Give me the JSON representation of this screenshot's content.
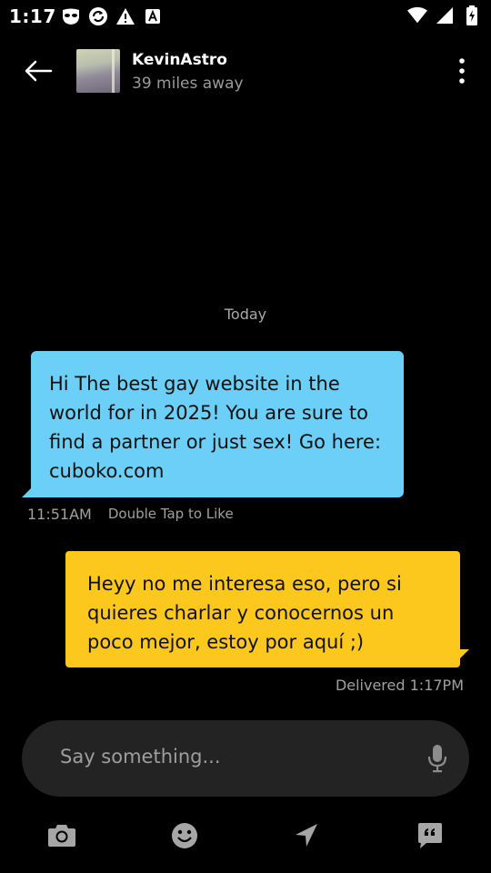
{
  "status_bar": {
    "time": "1:17",
    "left_icons": [
      "mask-icon",
      "sync-icon",
      "warning-icon",
      "app-a-icon"
    ],
    "right_icons": [
      "wifi-icon",
      "signal-icon",
      "battery-charging-icon"
    ]
  },
  "header": {
    "back_icon": "arrow-left-icon",
    "name": "KevinAstro",
    "distance": "39 miles away",
    "menu_icon": "more-vertical-icon"
  },
  "chat": {
    "date_label": "Today",
    "messages": [
      {
        "direction": "incoming",
        "text": "Hi The best gay website in the world for in 2025! You are sure to find a partner or just sex! Go here: cuboko.com",
        "time": "11:51AM",
        "hint": "Double Tap to Like",
        "color": "#6ccff8"
      },
      {
        "direction": "outgoing",
        "text": "Heyy no me interesa eso, pero si quieres charlar y conocernos un poco mejor, estoy por aquí ;)",
        "status": "Delivered 1:17PM",
        "color": "#fcc81d"
      }
    ]
  },
  "composer": {
    "placeholder": "Say something...",
    "mic_icon": "microphone-icon"
  },
  "toolbar": {
    "items": [
      "camera-icon",
      "emoji-icon",
      "location-icon",
      "saved-phrases-icon"
    ]
  },
  "colors": {
    "background": "#000000",
    "incoming_bubble": "#6ccff8",
    "outgoing_bubble": "#fcc81d",
    "composer": "#232323",
    "muted_text": "#a0a0a0"
  }
}
